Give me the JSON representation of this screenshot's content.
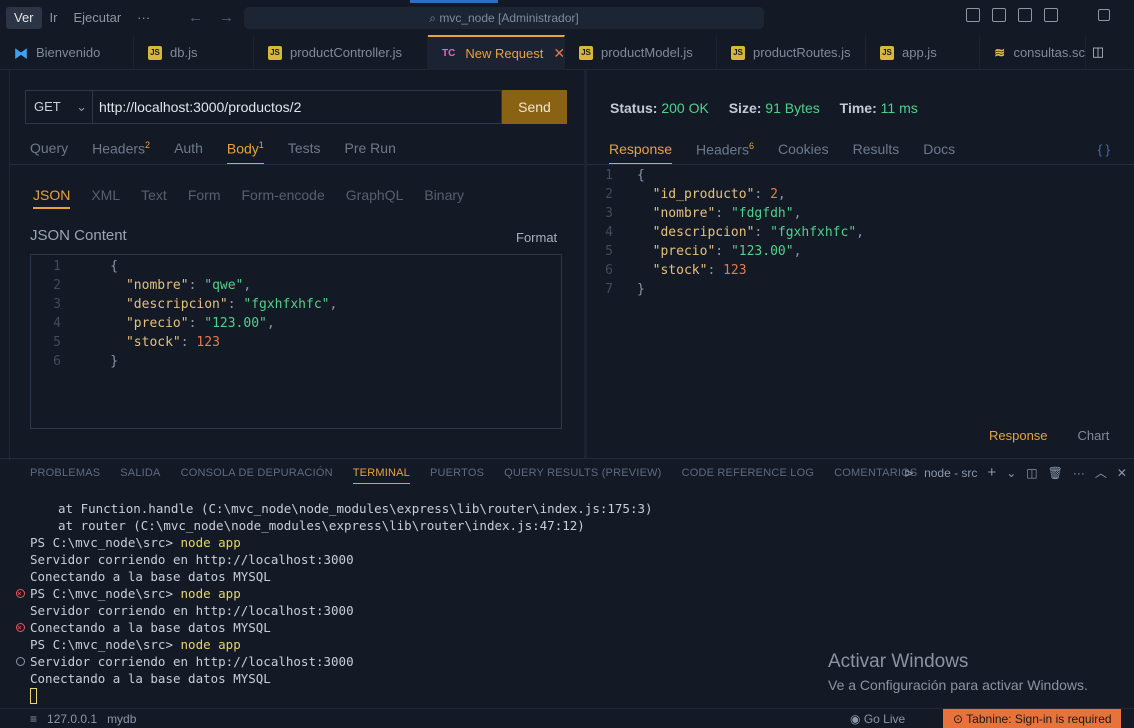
{
  "titlebar": {
    "menu": [
      "Ver",
      "Ir",
      "Ejecutar",
      "···"
    ],
    "search": "mvc_node [Administrador]"
  },
  "tabs": [
    {
      "label": "Bienvenido",
      "icon": "vscode-icon"
    },
    {
      "label": "db.js",
      "icon": "js-icon"
    },
    {
      "label": "productController.js",
      "icon": "js-icon"
    },
    {
      "label": "New Request",
      "icon": "tc-icon",
      "prefix": "TC",
      "active": true
    },
    {
      "label": "productModel.js",
      "icon": "js-icon"
    },
    {
      "label": "productRoutes.js",
      "icon": "js-icon"
    },
    {
      "label": "app.js",
      "icon": "js-icon"
    },
    {
      "label": "consultas.sc",
      "icon": "database-icon"
    }
  ],
  "request": {
    "method": "GET",
    "url": "http://localhost:3000/productos/2",
    "send_label": "Send",
    "tabs": [
      {
        "label": "Query",
        "badge": ""
      },
      {
        "label": "Headers",
        "badge": "2"
      },
      {
        "label": "Auth",
        "badge": ""
      },
      {
        "label": "Body",
        "badge": "1"
      },
      {
        "label": "Tests",
        "badge": ""
      },
      {
        "label": "Pre Run",
        "badge": ""
      }
    ],
    "body_tabs": [
      "JSON",
      "XML",
      "Text",
      "Form",
      "Form-encode",
      "GraphQL",
      "Binary"
    ],
    "json_title": "JSON Content",
    "format_label": "Format",
    "body_lines": [
      {
        "n": "1",
        "parts": [
          [
            "p",
            "    {"
          ]
        ]
      },
      {
        "n": "2",
        "parts": [
          [
            "p",
            "      "
          ],
          [
            "k",
            "\"nombre\""
          ],
          [
            "p",
            ": "
          ],
          [
            "s",
            "\"qwe\""
          ],
          [
            "p",
            ","
          ]
        ]
      },
      {
        "n": "3",
        "parts": [
          [
            "p",
            "      "
          ],
          [
            "k",
            "\"descripcion\""
          ],
          [
            "p",
            ": "
          ],
          [
            "s",
            "\"fgxhfxhfc\""
          ],
          [
            "p",
            ","
          ]
        ]
      },
      {
        "n": "4",
        "parts": [
          [
            "p",
            "      "
          ],
          [
            "k",
            "\"precio\""
          ],
          [
            "p",
            ": "
          ],
          [
            "s",
            "\"123.00\""
          ],
          [
            "p",
            ","
          ]
        ]
      },
      {
        "n": "5",
        "parts": [
          [
            "p",
            "      "
          ],
          [
            "k",
            "\"stock\""
          ],
          [
            "p",
            ": "
          ],
          [
            "n",
            "123"
          ]
        ]
      },
      {
        "n": "6",
        "parts": [
          [
            "p",
            "    }"
          ]
        ]
      }
    ]
  },
  "response": {
    "status_label": "Status:",
    "status_value": "200 OK",
    "size_label": "Size:",
    "size_value": "91 Bytes",
    "time_label": "Time:",
    "time_value": "11 ms",
    "tabs": [
      {
        "label": "Response",
        "badge": ""
      },
      {
        "label": "Headers",
        "badge": "6"
      },
      {
        "label": "Cookies",
        "badge": ""
      },
      {
        "label": "Results",
        "badge": ""
      },
      {
        "label": "Docs",
        "badge": ""
      }
    ],
    "braces": "{ }",
    "body_lines": [
      {
        "n": "1",
        "parts": [
          [
            "p",
            "{"
          ]
        ]
      },
      {
        "n": "2",
        "parts": [
          [
            "p",
            "  "
          ],
          [
            "k",
            "\"id_producto\""
          ],
          [
            "p",
            ": "
          ],
          [
            "n",
            "2"
          ],
          [
            "p",
            ","
          ]
        ]
      },
      {
        "n": "3",
        "parts": [
          [
            "p",
            "  "
          ],
          [
            "k",
            "\"nombre\""
          ],
          [
            "p",
            ": "
          ],
          [
            "s",
            "\"fdgfdh\""
          ],
          [
            "p",
            ","
          ]
        ]
      },
      {
        "n": "4",
        "parts": [
          [
            "p",
            "  "
          ],
          [
            "k",
            "\"descripcion\""
          ],
          [
            "p",
            ": "
          ],
          [
            "s",
            "\"fgxhfxhfc\""
          ],
          [
            "p",
            ","
          ]
        ]
      },
      {
        "n": "5",
        "parts": [
          [
            "p",
            "  "
          ],
          [
            "k",
            "\"precio\""
          ],
          [
            "p",
            ": "
          ],
          [
            "s",
            "\"123.00\""
          ],
          [
            "p",
            ","
          ]
        ]
      },
      {
        "n": "6",
        "parts": [
          [
            "p",
            "  "
          ],
          [
            "k",
            "\"stock\""
          ],
          [
            "p",
            ": "
          ],
          [
            "n",
            "123"
          ]
        ]
      },
      {
        "n": "7",
        "parts": [
          [
            "p",
            "}"
          ]
        ]
      }
    ],
    "bottom_tabs": [
      "Response",
      "Chart"
    ]
  },
  "panel": {
    "tabs": [
      "PROBLEMAS",
      "SALIDA",
      "CONSOLA DE DEPURACIÓN",
      "TERMINAL",
      "PUERTOS",
      "QUERY RESULTS (PREVIEW)",
      "CODE REFERENCE LOG",
      "COMENTARIOS"
    ],
    "active_tab": "TERMINAL",
    "terminal_name": "node - src",
    "lines": [
      {
        "type": "indent",
        "text": "at Function.handle (C:\\mvc_node\\node_modules\\express\\lib\\router\\index.js:175:3)"
      },
      {
        "type": "indent",
        "text": "at router (C:\\mvc_node\\node_modules\\express\\lib\\router\\index.js:47:12)"
      },
      {
        "type": "prompt",
        "text": "PS C:\\mvc_node\\src> ",
        "cmd": "node app",
        "dot": ""
      },
      {
        "type": "plain",
        "text": "Servidor corriendo en http://localhost:3000"
      },
      {
        "type": "plain",
        "text": "Conectando a la base datos MYSQL"
      },
      {
        "type": "prompt",
        "text": "PS C:\\mvc_node\\src> ",
        "cmd": "node app",
        "dot": "err"
      },
      {
        "type": "plain",
        "text": "Servidor corriendo en http://localhost:3000"
      },
      {
        "type": "plain",
        "text": "Conectando a la base datos MYSQL",
        "dot": "err"
      },
      {
        "type": "prompt",
        "text": "PS C:\\mvc_node\\src> ",
        "cmd": "node app",
        "dot": ""
      },
      {
        "type": "plain",
        "text": "Servidor corriendo en http://localhost:3000",
        "dot": "grey"
      },
      {
        "type": "plain",
        "text": "Conectando a la base datos MYSQL"
      }
    ]
  },
  "watermark": {
    "title": "Activar Windows",
    "subtitle": "Ve a Configuración para activar Windows."
  },
  "statusbar": {
    "host": "127.0.0.1",
    "db": "mydb",
    "golive": "Go Live",
    "tabnine": "Tabnine: Sign-in is required"
  }
}
